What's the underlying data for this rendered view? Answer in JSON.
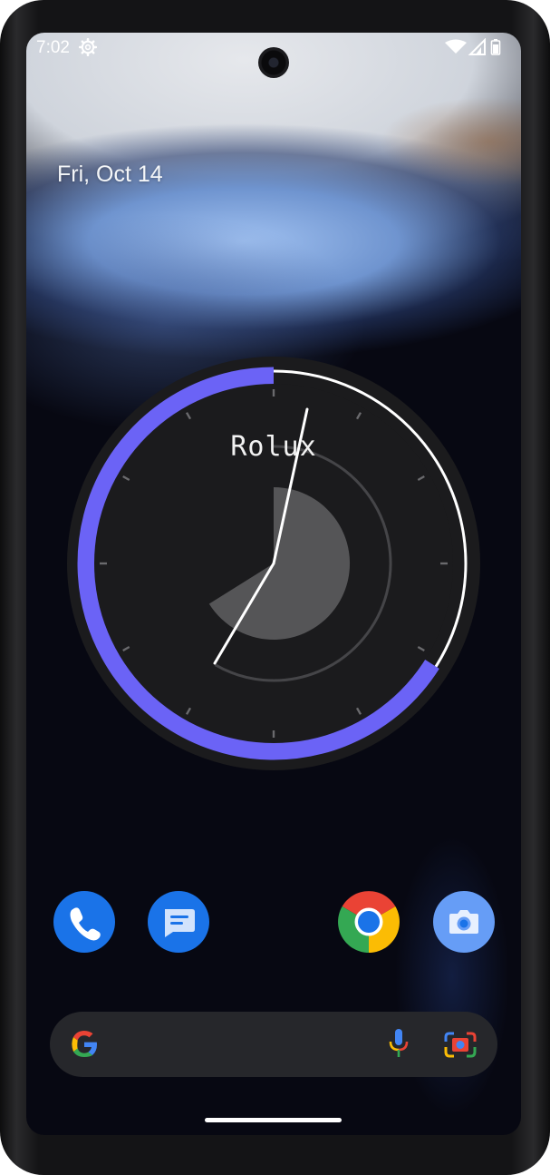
{
  "status_bar": {
    "time": "7:02",
    "icons": [
      "settings-gear-icon",
      "wifi-icon",
      "signal-icon",
      "battery-icon"
    ]
  },
  "home": {
    "date": "Fri, Oct 14"
  },
  "clock_widget": {
    "brand_label": "Rolux",
    "accent_color": "#6b63f6",
    "hand_color": "#ffffff",
    "purple_ring_fraction": 0.66,
    "time_shown": "7:02"
  },
  "dock": {
    "apps": [
      {
        "name": "Phone",
        "icon": "phone-icon",
        "color": "#1a73e8"
      },
      {
        "name": "Messages",
        "icon": "messages-icon",
        "color": "#1a73e8"
      },
      {
        "name": "Chrome",
        "icon": "chrome-icon",
        "color": "#ea4335"
      },
      {
        "name": "Camera",
        "icon": "camera-icon",
        "color": "#669df6"
      }
    ]
  },
  "search": {
    "icons": [
      "google-g-icon",
      "microphone-icon",
      "google-lens-icon"
    ]
  }
}
